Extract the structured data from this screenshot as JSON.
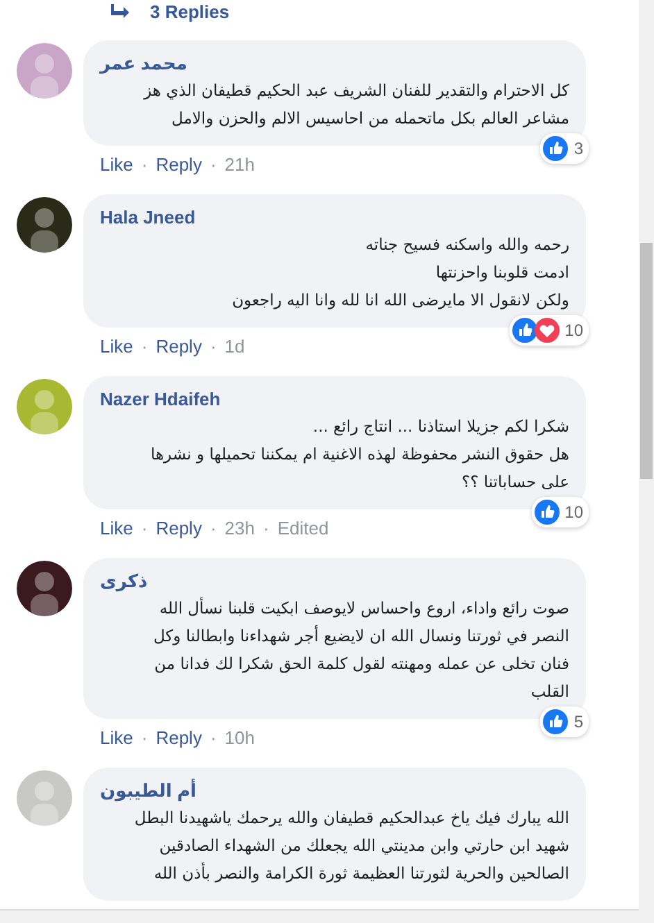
{
  "replies_link": {
    "label": "3 Replies"
  },
  "comments": [
    {
      "author": "محمد عمر",
      "lines": [
        "كل الاحترام والتقدير للفنان الشريف عبد الحكيم قطيفان الذي هز",
        "مشاعر العالم بكل ماتحمله من احاسيس الالم والحزن والامل"
      ],
      "reactions": [
        {
          "kind": "like"
        }
      ],
      "reaction_count": "3",
      "like_link": {
        "text": "Like",
        "sep": "·"
      },
      "reply_link": {
        "text": "Reply",
        "sep": "·"
      },
      "time": {
        "text": "21h"
      }
    },
    {
      "author": "Hala Jneed",
      "lines": [
        "رحمه والله واسكنه فسيح جناته",
        "ادمت قلوبنا واحزنتها",
        "ولكن لانقول الا مايرضى الله انا لله وانا اليه راجعون"
      ],
      "reactions": [
        {
          "kind": "like"
        },
        {
          "kind": "love"
        }
      ],
      "reaction_count": "10",
      "like_link": {
        "text": "Like",
        "sep": "·"
      },
      "reply_link": {
        "text": "Reply",
        "sep": "·"
      },
      "time": {
        "text": "1d"
      }
    },
    {
      "author": "Nazer Hdaifeh",
      "lines": [
        "شكرا لكم جزيلا استاذنا ... انتاج رائع ...",
        "هل حقوق النشر محفوظة لهذه الاغنية ام يمكننا تحميلها و نشرها",
        "على حساباتنا ؟؟"
      ],
      "reactions": [
        {
          "kind": "like"
        }
      ],
      "reaction_count": "10",
      "like_link": {
        "text": "Like",
        "sep": "·"
      },
      "reply_link": {
        "text": "Reply",
        "sep": "·"
      },
      "time": {
        "text": "23h",
        "sep": "·"
      },
      "edited": "Edited"
    },
    {
      "author": "ذكرى",
      "lines": [
        "صوت رائع واداء، اروع واحساس لايوصف ابكيت قلبنا نسأل الله",
        "النصر في ثورتنا ونسال الله ان لايضيع أجر شهداءنا وابطالنا وكل",
        "فنان تخلى عن عمله ومهنته لقول كلمة الحق شكرا لك فدانا من",
        "القلب"
      ],
      "reactions": [
        {
          "kind": "like"
        }
      ],
      "reaction_count": "5",
      "like_link": {
        "text": "Like",
        "sep": "·"
      },
      "reply_link": {
        "text": "Reply",
        "sep": "·"
      },
      "time": {
        "text": "10h"
      }
    },
    {
      "author": "أم الطيبون",
      "lines": [
        "الله يبارك فيك ياخ عبدالحكيم قطيفان والله يرحمك ياشهيدنا البطل",
        "شهيد ابن حارتي وابن مدينتي الله يجعلك من الشهداء الصادقين",
        "الصالحين والحرية لثورتنا العظيمة ثورة الكرامة والنصر بأذن الله"
      ]
    }
  ]
}
